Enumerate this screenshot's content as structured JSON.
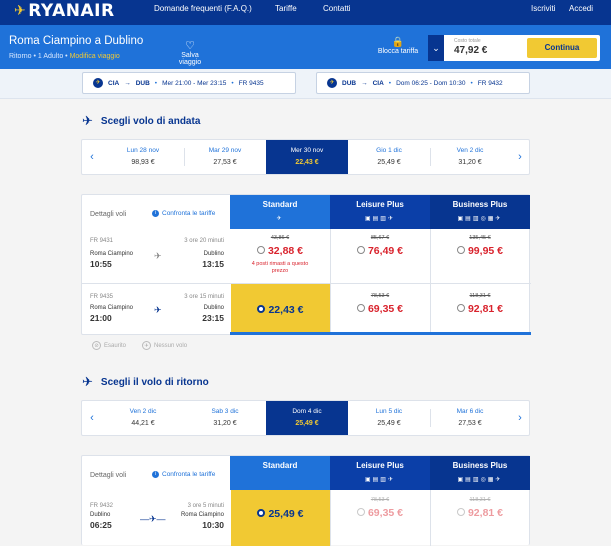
{
  "brand": {
    "name": "RYANAIR"
  },
  "nav": {
    "faq": "Domande frequenti (F.A.Q.)",
    "tariffe": "Tariffe",
    "contatti": "Contatti",
    "iscriviti": "Iscriviti",
    "accedi": "Accedi"
  },
  "trip": {
    "route": "Roma Ciampino a Dublino",
    "type": "Ritorno",
    "pax": "1 Adulto",
    "modify": "Modifica viaggio",
    "save": "Salva viaggio",
    "lock": "Blocca tariffa",
    "total_label": "Costo totale",
    "total": "47,92 €",
    "continue": "Continua"
  },
  "summary": {
    "out": {
      "from": "CIA",
      "to": "DUB",
      "when": "Mer 21:00 - Mer 23:15",
      "flight": "FR 9435"
    },
    "ret": {
      "from": "DUB",
      "to": "CIA",
      "when": "Dom 06:25 - Dom 10:30",
      "flight": "FR 9432"
    }
  },
  "outbound": {
    "title": "Scegli volo di andata",
    "dates": [
      {
        "day": "Lun 28 nov",
        "price": "98,93 €"
      },
      {
        "day": "Mar 29 nov",
        "price": "27,53 €"
      },
      {
        "day": "Mer 30 nov",
        "price": "22,43 €"
      },
      {
        "day": "Gio 1 dic",
        "price": "25,49 €"
      },
      {
        "day": "Ven 2 dic",
        "price": "31,20 €"
      }
    ],
    "details": "Dettagli voli",
    "compare": "Confronta le tariffe",
    "fares": [
      "Standard",
      "Leisure Plus",
      "Business Plus"
    ],
    "flights": [
      {
        "flight": "FR 9431",
        "duration": "3 ore 20 minuti",
        "from": "Roma Ciampino",
        "to": "Dublino",
        "dep": "10:55",
        "arr": "13:15",
        "std_old": "43,86 €",
        "std": "32,88 €",
        "warn": "4 posti rimasti a questo prezzo",
        "lp_old": "85,67 €",
        "lp": "76,49 €",
        "bp_old": "135,45 €",
        "bp": "99,95 €"
      },
      {
        "flight": "FR 9435",
        "duration": "3 ore 15 minuti",
        "from": "Roma Ciampino",
        "to": "Dublino",
        "dep": "21:00",
        "arr": "23:15",
        "std": "22,43 €",
        "lp_old": "78,53 €",
        "lp": "69,35 €",
        "bp_old": "118,31 €",
        "bp": "92,81 €"
      }
    ],
    "legend": [
      "Esaurito",
      "Nessun volo"
    ]
  },
  "return": {
    "title": "Scegli il volo di ritorno",
    "dates": [
      {
        "day": "Ven 2 dic",
        "price": "44,21 €"
      },
      {
        "day": "Sab 3 dic",
        "price": "31,20 €"
      },
      {
        "day": "Dom 4 dic",
        "price": "25,49 €"
      },
      {
        "day": "Lun 5 dic",
        "price": "25,49 €"
      },
      {
        "day": "Mar 6 dic",
        "price": "27,53 €"
      }
    ],
    "details": "Dettagli voli",
    "compare": "Confronta le tariffe",
    "fares": [
      "Standard",
      "Leisure Plus",
      "Business Plus"
    ],
    "flights": [
      {
        "flight": "FR 9432",
        "duration": "3 ore 5 minuti",
        "from": "Dublino",
        "to": "Roma Ciampino",
        "dep": "06:25",
        "arr": "10:30",
        "std": "25,49 €",
        "lp_old": "78,53 €",
        "lp": "69,35 €",
        "bp_old": "118,31 €",
        "bp": "92,81 €"
      }
    ]
  },
  "colors": {
    "navy": "#073590",
    "blue": "#1f72d9",
    "yellow": "#f1c933",
    "red": "#d9232d"
  }
}
